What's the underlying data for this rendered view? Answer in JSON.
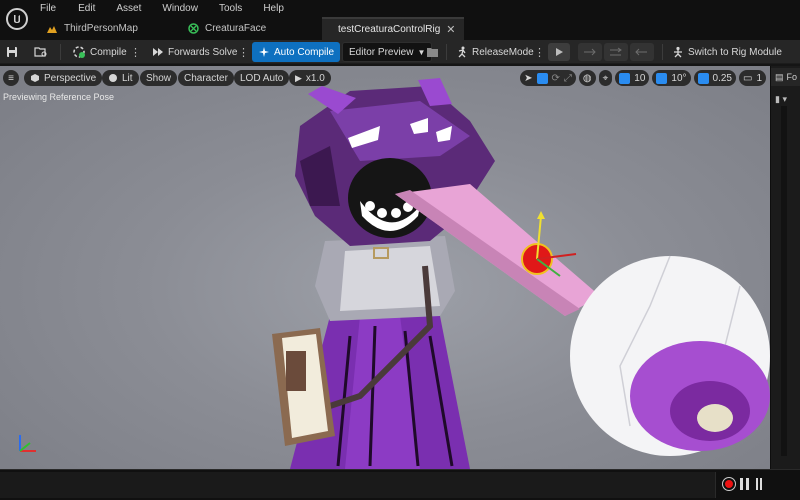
{
  "menu": {
    "items": [
      "File",
      "Edit",
      "Asset",
      "Window",
      "Tools",
      "Help"
    ]
  },
  "tabs": [
    {
      "label": "ThirdPersonMap",
      "icon": "level-icon"
    },
    {
      "label": "CreaturaFace",
      "icon": "blueprint-icon"
    },
    {
      "label": "testCreaturaControlRig",
      "icon": "control-rig-icon",
      "active": true
    }
  ],
  "toolbar": {
    "compile_label": "Compile",
    "forwards_solve_label": "Forwards Solve",
    "auto_compile_label": "Auto Compile",
    "editor_preview_label": "Editor Preview",
    "release_mode_label": "ReleaseMode",
    "switch_rig_label": "Switch to Rig Module"
  },
  "viewport": {
    "perspective_label": "Perspective",
    "lit_label": "Lit",
    "show_label": "Show",
    "character_label": "Character",
    "lod_label": "LOD Auto",
    "speed_label": "x1.0",
    "preview_text": "Previewing Reference Pose",
    "grid_snap": "10",
    "rot_snap": "10°",
    "scale_snap": "0.25",
    "camera_speed": "1"
  },
  "dock": {
    "tab_label": "Fo"
  },
  "colors": {
    "accent": "#0e70c0",
    "record": "#e11111",
    "creature_purple": "#7a2fb0",
    "tongue_pink": "#e8a4d6"
  }
}
